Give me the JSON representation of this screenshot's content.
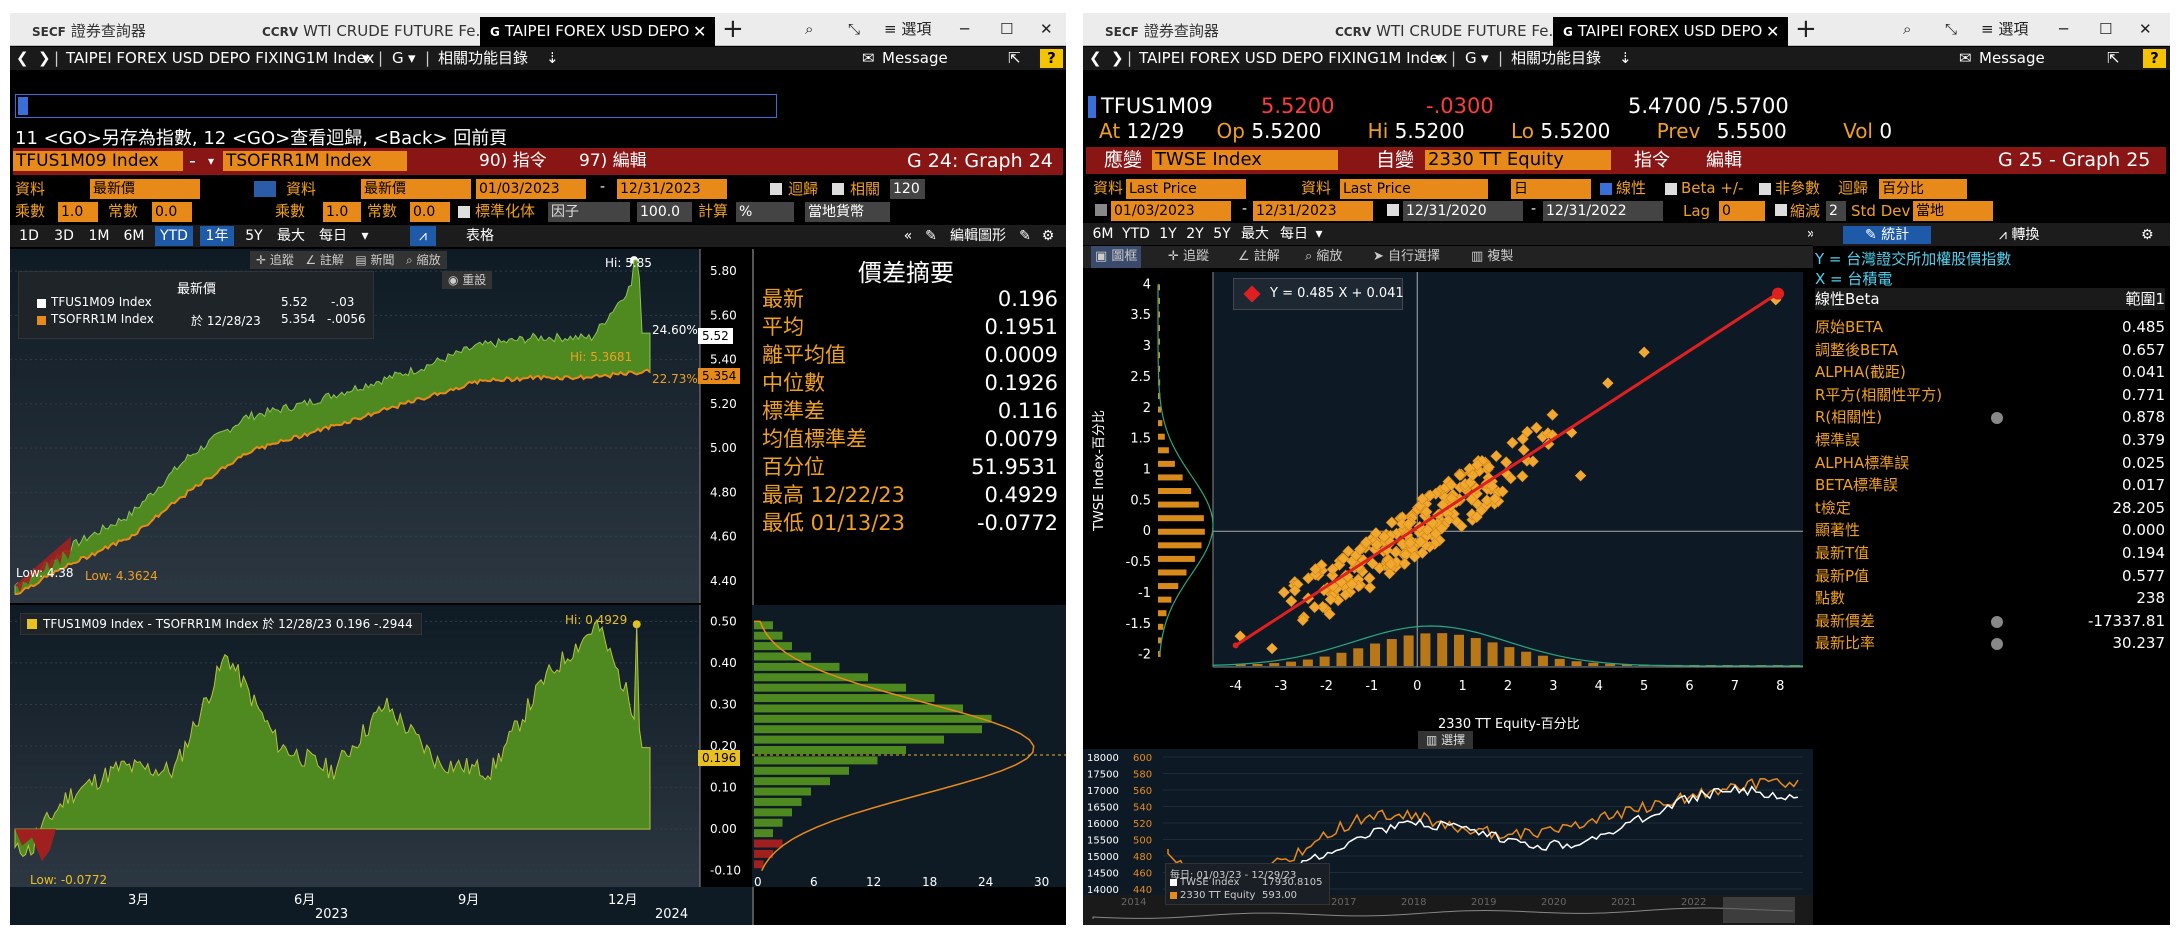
{
  "left": {
    "tabs": [
      {
        "code": "SECF",
        "label": "證券查詢器"
      },
      {
        "code": "CCRV",
        "label": "WTI CRUDE FUTURE Fe..."
      },
      {
        "code": "G",
        "label": "TAIPEI FOREX USD DEPO"
      }
    ],
    "window_controls": {
      "search": "⌕",
      "resize": "⤡",
      "options": "≡ 選項",
      "min": "─",
      "max": "☐",
      "close": "✕"
    },
    "nav": {
      "security": "TAIPEI FOREX USD DEPO FIXING1M Index",
      "func": "G",
      "menu": "相關功能目錄",
      "message": "Message",
      "help": "?"
    },
    "hint": "11 <GO>另存為指數, 12 <GO>查看迴歸, <Back> 回前頁",
    "sec1": "TFUS1M09 Index",
    "sec2": "TSOFRR1M Index",
    "cmd1": "90) 指令",
    "cmd2": "97) 編輯",
    "graph": "G 24: Graph 24",
    "row1": {
      "data_lbl": "資料",
      "data1": "最新價",
      "data_lbl2": "資料",
      "data2": "最新價",
      "date_from": "01/03/2023",
      "date_to": "12/31/2023",
      "regress": "迴歸",
      "corr": "相關",
      "corr_val": "120"
    },
    "row2": {
      "mult": "乘數",
      "mult_v": "1.0",
      "const": "常數",
      "const_v": "0.0",
      "mult2": "乘數",
      "mult2_v": "1.0",
      "const2": "常數",
      "const2_v": "0.0",
      "std": "標準化体",
      "factor": "因子",
      "factor_v": "100.0",
      "calc": "計算",
      "calc_v": "%",
      "ccy": "當地貨幣"
    },
    "periods": [
      "1D",
      "3D",
      "1M",
      "6M",
      "YTD",
      "1年",
      "5Y",
      "最大",
      "每日"
    ],
    "selected_periods": [
      "YTD",
      "1年"
    ],
    "table_btn": "表格",
    "edit_graph": "編輯圖形",
    "tools": [
      "追蹤",
      "註解",
      "新聞",
      "縮放"
    ],
    "reset": "重設",
    "legend": {
      "title": "最新價",
      "s1": "TFUS1M09 Index",
      "s1_v": "5.52",
      "s1_c": "-.03",
      "s2": "TSOFRR1M Index",
      "s2_at": "於 12/28/23",
      "s2_v": "5.354",
      "s2_c": "-.0056"
    },
    "top_y": [
      "5.80",
      "5.60",
      "5.40",
      "5.20",
      "5.00",
      "4.80",
      "4.60",
      "4.40"
    ],
    "hi": "Hi: 5.85",
    "hi2": "Hi: 5.3681",
    "low": "Low: 4.38",
    "low2": "Low: 4.3624",
    "pct1": "24.60%",
    "pct2": "22.73%",
    "last1": "5.52",
    "last2": "5.354",
    "spread_legend": "TFUS1M09 Index - TSOFRR1M Index 於 12/28/23 0.196  -.2944",
    "spread_hi": "Hi: 0.4929",
    "spread_low": "Low: -0.0772",
    "spread_last": "0.196",
    "bot_y": [
      "0.50",
      "0.40",
      "0.30",
      "0.20",
      "0.10",
      "0.00",
      "-0.10"
    ],
    "x_months": [
      "3月",
      "6月",
      "9月",
      "12月"
    ],
    "x_years": [
      "2023",
      "2024"
    ],
    "hist_x": [
      "0",
      "6",
      "12",
      "18",
      "24",
      "30"
    ],
    "summary_title": "價差摘要",
    "summary": [
      {
        "k": "最新",
        "v": "0.196"
      },
      {
        "k": "平均",
        "v": "0.1951"
      },
      {
        "k": "離平均值",
        "v": "0.0009"
      },
      {
        "k": "中位數",
        "v": "0.1926"
      },
      {
        "k": "標準差",
        "v": "0.116"
      },
      {
        "k": "均值標準差",
        "v": "0.0079"
      },
      {
        "k": "百分位",
        "v": "51.9531"
      },
      {
        "k": "最高 12/22/23",
        "v": "0.4929"
      },
      {
        "k": "最低 01/13/23",
        "v": "-0.0772"
      }
    ]
  },
  "right": {
    "tabs": [
      {
        "code": "SECF",
        "label": "證券查詢器"
      },
      {
        "code": "CCRV",
        "label": "WTI CRUDE FUTURE Fe..."
      },
      {
        "code": "G",
        "label": "TAIPEI FOREX USD DEPO"
      }
    ],
    "window_controls": {
      "search": "⌕",
      "resize": "⤡",
      "options": "≡ 選項",
      "min": "─",
      "max": "☐",
      "close": "✕"
    },
    "nav": {
      "security": "TAIPEI FOREX USD DEPO FIXING1M Index",
      "func": "G",
      "menu": "相關功能目錄",
      "message": "Message",
      "help": "?"
    },
    "ticker": "TFUS1M09",
    "price": "5.5200",
    "change": "-.0300",
    "bidask": "5.4700 /5.5700",
    "quote": {
      "at": "At",
      "date": "12/29",
      "op": "Op",
      "op_v": "5.5200",
      "hi": "Hi",
      "hi_v": "5.5200",
      "lo": "Lo",
      "lo_v": "5.5200",
      "prev": "Prev",
      "prev_v": "5.5500",
      "vol": "Vol",
      "vol_v": "0"
    },
    "dep": "應變",
    "dep_sec": "TWSE Index",
    "indep": "自變",
    "indep_sec": "2330 TT Equity",
    "cmd": "指令",
    "edit": "編輯",
    "graph": "G 25 - Graph 25",
    "row1": {
      "data": "資料",
      "d1": "Last Price",
      "data2": "資料",
      "d2": "Last Price",
      "freq": "日",
      "linear": "線性",
      "beta": "Beta +/-",
      "nonparam": "非參數",
      "regress": "迴歸",
      "regress_v": "百分比"
    },
    "row2": {
      "d1": "01/03/2023",
      "d2": "12/31/2023",
      "d3": "12/31/2020",
      "d4": "12/31/2022",
      "lag": "Lag",
      "lag_v": "0",
      "shrink": "縮減",
      "shrink_v": "2",
      "std": "Std Dev",
      "ccy": "當地"
    },
    "periods": [
      "6M",
      "YTD",
      "1Y",
      "2Y",
      "5Y",
      "最大",
      "每日"
    ],
    "tools": [
      "圖框",
      "追蹤",
      "註解",
      "縮放",
      "自行選擇",
      "複製"
    ],
    "stats_btn": "統計",
    "convert_btn": "轉換",
    "y_desc": "Y = 台灣證交所加權股價指數",
    "x_desc": "X = 台積電",
    "stats_head": {
      "k": "線性Beta",
      "v": "範圍1"
    },
    "stats": [
      {
        "k": "原始BETA",
        "v": "0.485"
      },
      {
        "k": "調整後BETA",
        "v": "0.657"
      },
      {
        "k": "ALPHA(截距)",
        "v": "0.041"
      },
      {
        "k": "R平方(相關性平方)",
        "v": "0.771"
      },
      {
        "k": "R(相關性)",
        "v": "0.878",
        "icon": true
      },
      {
        "k": "標準誤",
        "v": "0.379"
      },
      {
        "k": "ALPHA標準誤",
        "v": "0.025"
      },
      {
        "k": "BETA標準誤",
        "v": "0.017"
      },
      {
        "k": "t檢定",
        "v": "28.205"
      },
      {
        "k": "顯著性",
        "v": "0.000"
      },
      {
        "k": "最新T值",
        "v": "0.194"
      },
      {
        "k": "最新P值",
        "v": "0.577"
      },
      {
        "k": "點數",
        "v": "238"
      },
      {
        "k": "最新價差",
        "v": "-17337.81",
        "icon": true
      },
      {
        "k": "最新比率",
        "v": "30.237",
        "icon": true
      }
    ],
    "equation": "Y = 0.485 X + 0.041",
    "scatter_y": [
      "4",
      "3.5",
      "3",
      "2.5",
      "2",
      "1.5",
      "1",
      "0.5",
      "0",
      "-0.5",
      "-1",
      "-1.5",
      "-2"
    ],
    "scatter_x": [
      "-4",
      "-3",
      "-2",
      "-1",
      "0",
      "1",
      "2",
      "3",
      "4",
      "5",
      "6",
      "7",
      "8"
    ],
    "xlabel": "2330 TT Equity-百分比",
    "ylabel": "TWSE Index-百分比",
    "select_btn": "選擇",
    "mini_y1": [
      "18000",
      "17500",
      "17000",
      "16500",
      "16000",
      "15500",
      "15000",
      "14500",
      "14000"
    ],
    "mini_y2": [
      "600",
      "580",
      "560",
      "540",
      "520",
      "500",
      "480",
      "460",
      "440"
    ],
    "mini_legend": {
      "title": "每日: 01/03/23 - 12/29/23",
      "s1": "TWSE Index",
      "s1_v": "17930.8105",
      "s2": "2330 TT Equity",
      "s2_v": "593.00"
    },
    "mini_years": [
      "2014",
      "2015",
      "2016",
      "2017",
      "2018",
      "2019",
      "2020",
      "2021",
      "2022"
    ]
  },
  "chart_data": [
    {
      "type": "area",
      "title": "TFUS1M09 Index / TSOFRR1M Index",
      "series": [
        {
          "name": "TFUS1M09 Index",
          "values": [
            4.38,
            4.56,
            4.7,
            4.96,
            5.14,
            5.2,
            5.28,
            5.36,
            5.46,
            5.5,
            5.5,
            5.85,
            5.52
          ]
        },
        {
          "name": "TSOFRR1M Index",
          "values": [
            4.36,
            4.5,
            4.62,
            4.82,
            5.0,
            5.08,
            5.16,
            5.24,
            5.32,
            5.34,
            5.34,
            5.3681,
            5.354
          ]
        }
      ],
      "ylim": [
        4.3,
        5.9
      ]
    },
    {
      "type": "area",
      "series": [
        {
          "name": "TFUS1M09 Index - TSOFRR1M Index",
          "values": [
            -0.0772,
            0.08,
            0.15,
            0.14,
            0.42,
            0.2,
            0.14,
            0.3,
            0.16,
            0.14,
            0.36,
            0.4929,
            0.196
          ]
        }
      ],
      "ylim": [
        -0.12,
        0.52
      ]
    },
    {
      "type": "scatter",
      "xlabel": "2330 TT Equity-百分比",
      "ylabel": "TWSE Index-百分比",
      "xlim": [
        -4.5,
        8.5
      ],
      "ylim": [
        -2.2,
        4.2
      ],
      "regression": {
        "beta": 0.485,
        "alpha": 0.041
      }
    }
  ]
}
